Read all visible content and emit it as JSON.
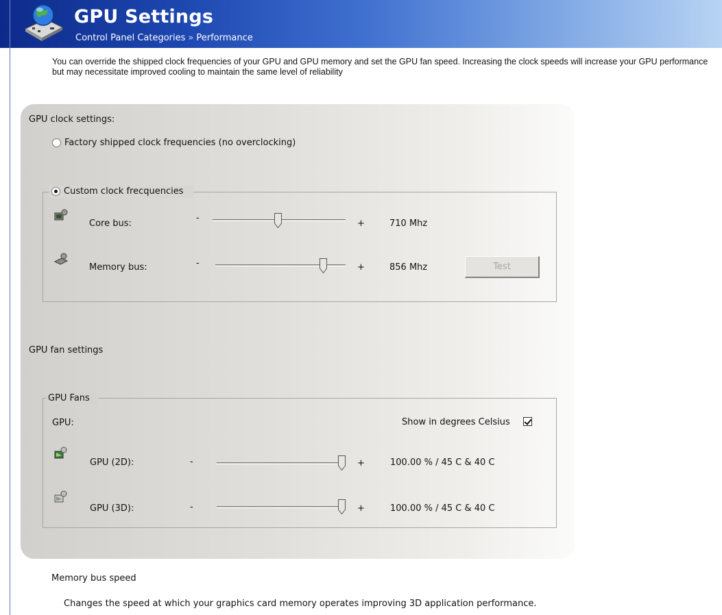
{
  "header": {
    "title": "GPU Settings",
    "breadcrumb": [
      "Control Panel Categories",
      "Performance"
    ],
    "breadcrumb_separator": "»",
    "logo_icon": "globe-gpu-card-icon"
  },
  "intro_text": "You can override the shipped clock frequencies of your GPU and GPU memory and set the GPU fan speed. Increasing the clock speeds will increase your GPU performance but may necessitate improved cooling to maintain the same level of reliability",
  "clock": {
    "section_label": "GPU clock settings:",
    "factory_option": {
      "label": "Factory shipped clock frequencies (no overclocking)",
      "selected": false
    },
    "custom_option": {
      "label": "Custom clock frecquencies",
      "selected": true
    },
    "core": {
      "label": "Core bus:",
      "minus": "-",
      "plus": "+",
      "value": "710 Mhz",
      "slider_fraction": 0.49,
      "icon": "core-chip-icon"
    },
    "memory": {
      "label": "Memory bus:",
      "minus": "-",
      "plus": "+",
      "value": "856 Mhz",
      "slider_fraction": 0.85,
      "icon": "memory-chip-icon"
    },
    "test_button": {
      "label": "Test",
      "enabled": false
    }
  },
  "fan": {
    "section_label": "GPU fan settings",
    "group_label": "GPU Fans",
    "gpu_label": "GPU:",
    "celsius": {
      "label": "Show in degrees Celsius",
      "checked": true
    },
    "fan2d": {
      "label": "GPU (2D):",
      "minus": "-",
      "plus": "+",
      "value": "100.00 % / 45 C & 40 C",
      "slider_fraction": 1.0,
      "icon": "fan-2d-icon"
    },
    "fan3d": {
      "label": "GPU (3D):",
      "minus": "-",
      "plus": "+",
      "value": "100.00 % / 45 C & 40 C",
      "slider_fraction": 1.0,
      "icon": "fan-3d-icon"
    }
  },
  "help": {
    "title": "Memory bus speed",
    "description": "Changes the speed at which your graphics card memory operates improving 3D application performance."
  }
}
